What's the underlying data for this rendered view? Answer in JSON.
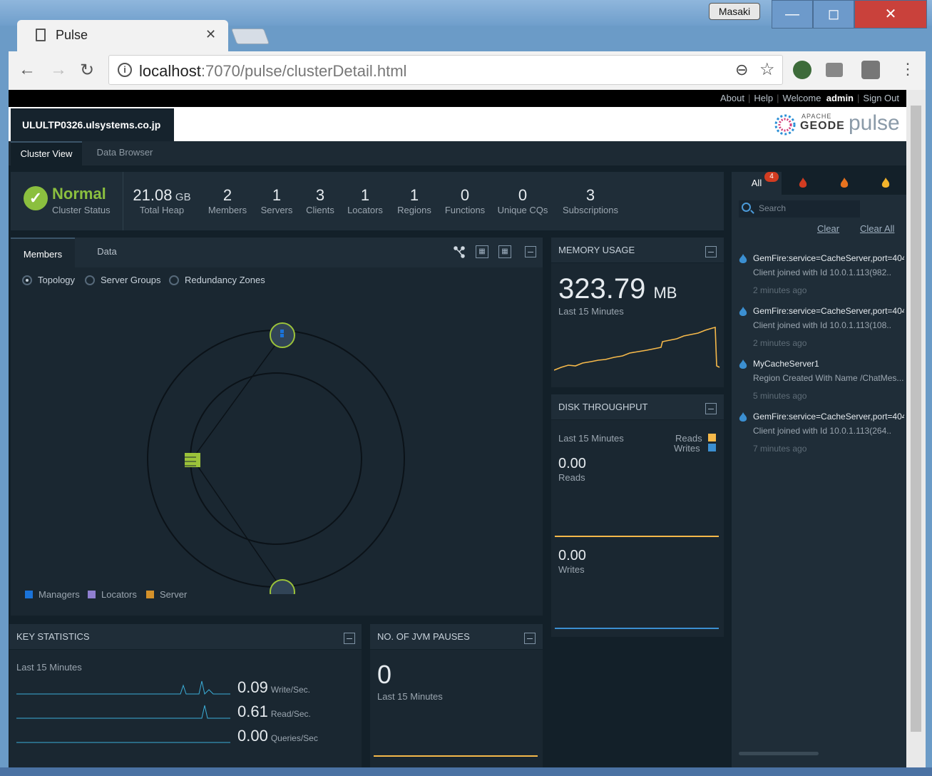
{
  "window": {
    "user": "Masaki",
    "tab_title": "Pulse",
    "url_host": "localhost",
    "url_path": ":7070/pulse/clusterDetail.html"
  },
  "topnav": {
    "about": "About",
    "help": "Help",
    "welcome": "Welcome",
    "user": "admin",
    "signout": "Sign Out"
  },
  "header": {
    "cluster_name": "ULULTP0326.ulsystems.co.jp",
    "logo_apache": "APACHE",
    "logo_geode": "GEODE",
    "logo_pulse": "pulse"
  },
  "tabs": {
    "cluster_view": "Cluster View",
    "data_browser": "Data Browser"
  },
  "status": {
    "state": "Normal",
    "label": "Cluster Status",
    "metrics": [
      {
        "value": "21.08",
        "unit": "GB",
        "label": "Total Heap"
      },
      {
        "value": "2",
        "unit": "",
        "label": "Members"
      },
      {
        "value": "1",
        "unit": "",
        "label": "Servers"
      },
      {
        "value": "3",
        "unit": "",
        "label": "Clients"
      },
      {
        "value": "1",
        "unit": "",
        "label": "Locators"
      },
      {
        "value": "1",
        "unit": "",
        "label": "Regions"
      },
      {
        "value": "0",
        "unit": "",
        "label": "Functions"
      },
      {
        "value": "0",
        "unit": "",
        "label": "Unique CQs"
      },
      {
        "value": "3",
        "unit": "",
        "label": "Subscriptions"
      }
    ]
  },
  "members": {
    "tab_members": "Members",
    "tab_data": "Data",
    "radio_topology": "Topology",
    "radio_server_groups": "Server Groups",
    "radio_redundancy_zones": "Redundancy Zones",
    "legend": [
      {
        "label": "Managers",
        "color": "#1a73d9"
      },
      {
        "label": "Locators",
        "color": "#8f7fd0"
      },
      {
        "label": "Server",
        "color": "#d4912a"
      }
    ]
  },
  "memory": {
    "title": "MEMORY USAGE",
    "value": "323.79",
    "unit": "MB",
    "period": "Last 15 Minutes",
    "color": "#f6b94a"
  },
  "disk": {
    "title": "DISK THROUGHPUT",
    "period": "Last 15 Minutes",
    "legend_reads": "Reads",
    "legend_writes": "Writes",
    "reads_value": "0.00",
    "reads_label": "Reads",
    "writes_value": "0.00",
    "writes_label": "Writes",
    "reads_color": "#f6b94a",
    "writes_color": "#3b8fd1"
  },
  "key_stats": {
    "title": "KEY STATISTICS",
    "period": "Last 15 Minutes",
    "rows": [
      {
        "value": "0.09",
        "unit": "Write/Sec."
      },
      {
        "value": "0.61",
        "unit": "Read/Sec."
      },
      {
        "value": "0.00",
        "unit": "Queries/Sec"
      }
    ]
  },
  "jvm": {
    "title": "NO. OF JVM PAUSES",
    "value": "0",
    "period": "Last 15 Minutes"
  },
  "alerts": {
    "tab_all": "All",
    "badge": "4",
    "search_placeholder": "Search",
    "clear": "Clear",
    "clear_all": "Clear All",
    "items": [
      {
        "title": "GemFire:service=CacheServer,port=404",
        "desc": "Client joined with Id 10.0.1.113(982..",
        "time": "2 minutes ago"
      },
      {
        "title": "GemFire:service=CacheServer,port=404",
        "desc": "Client joined with Id 10.0.1.113(108..",
        "time": "2 minutes ago"
      },
      {
        "title": "MyCacheServer1",
        "desc": "Region Created With Name /ChatMes...",
        "time": "5 minutes ago"
      },
      {
        "title": "GemFire:service=CacheServer,port=404",
        "desc": "Client joined with Id 10.0.1.113(264..",
        "time": "7 minutes ago"
      }
    ]
  }
}
